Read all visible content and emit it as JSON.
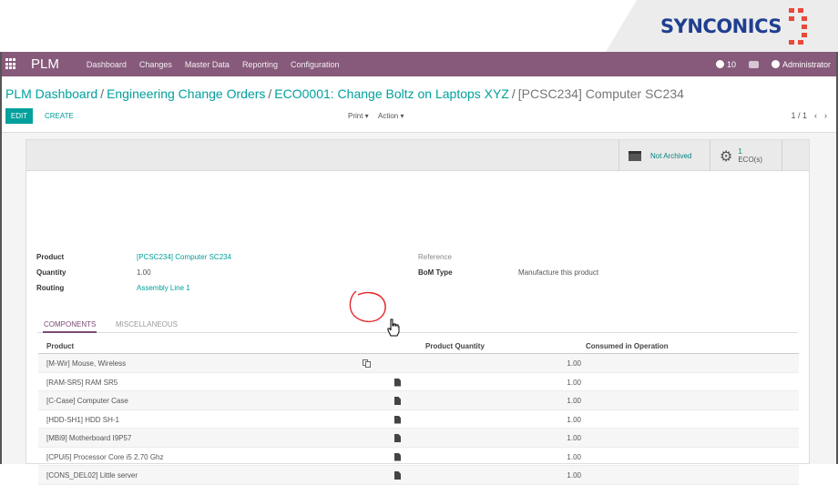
{
  "logo": {
    "text": "SYNCONICS"
  },
  "navbar": {
    "brand": "PLM",
    "menu": [
      "Dashboard",
      "Changes",
      "Master Data",
      "Reporting",
      "Configuration"
    ],
    "notifications": "10",
    "user": "Administrator"
  },
  "breadcrumb": {
    "items": [
      "PLM Dashboard",
      "Engineering Change Orders",
      "ECO0001: Change Boltz on Laptops XYZ"
    ],
    "current": "[PCSC234] Computer SC234",
    "separator": "/"
  },
  "toolbar": {
    "edit": "EDIT",
    "create": "CREATE",
    "print": "Print ▾",
    "action": "Action ▾",
    "pager": "1 / 1",
    "prev": "‹",
    "next": "›"
  },
  "stat_buttons": {
    "archived": "Not Archived",
    "eco_count": "1",
    "eco_label": "ECO(s)"
  },
  "fields": {
    "product_label": "Product",
    "product_value": "[PCSC234] Computer SC234",
    "quantity_label": "Quantity",
    "quantity_value": "1.00",
    "routing_label": "Routing",
    "routing_value": "Assembly Line 1",
    "reference_label": "Reference",
    "bom_type_label": "BoM Type",
    "bom_type_value": "Manufacture this product"
  },
  "tabs": [
    "COMPONENTS",
    "MISCELLANEOUS"
  ],
  "table": {
    "headers": [
      "Product",
      "Product Quantity",
      "Consumed in Operation"
    ],
    "rows": [
      {
        "product": "[M-Wir] Mouse, Wireless",
        "qty": "1.00"
      },
      {
        "product": "[RAM-SR5] RAM SR5",
        "qty": "1.00"
      },
      {
        "product": "[C-Case] Computer Case",
        "qty": "1.00"
      },
      {
        "product": "[HDD-SH1] HDD SH-1",
        "qty": "1.00"
      },
      {
        "product": "[MBi9] Motherboard I9P57",
        "qty": "1.00"
      },
      {
        "product": "[CPUi5] Processor Core i5 2.70 Ghz",
        "qty": "1.00"
      },
      {
        "product": "[CONS_DEL02] Little server",
        "qty": "1.00"
      }
    ]
  },
  "colors": {
    "navbar": "#875a7b",
    "accent": "#00a09d",
    "annotation": "#e3262b"
  }
}
